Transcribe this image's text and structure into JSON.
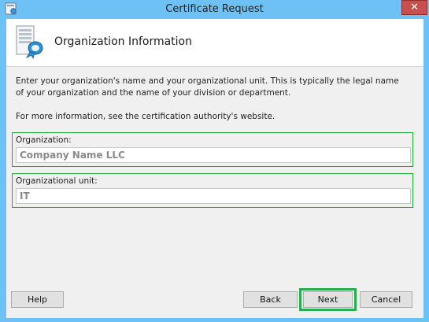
{
  "window": {
    "title": "Certificate Request",
    "close_label": "✕"
  },
  "header": {
    "title": "Organization Information",
    "icon": "certificate-server-icon"
  },
  "description": {
    "line1": "Enter your organization's name and your organizational unit. This is typically the legal name of your organization and the name of your division or department.",
    "line2": "For more information, see the certification authority's website."
  },
  "fields": {
    "organization": {
      "label": "Organization:",
      "value": "Company Name LLC"
    },
    "organizational_unit": {
      "label": "Organizational unit:",
      "value": "IT"
    }
  },
  "buttons": {
    "help": "Help",
    "back": "Back",
    "next": "Next",
    "cancel": "Cancel"
  },
  "colors": {
    "window_frame": "#6ec1f5",
    "highlight": "#22b14c",
    "close": "#c7504f"
  }
}
